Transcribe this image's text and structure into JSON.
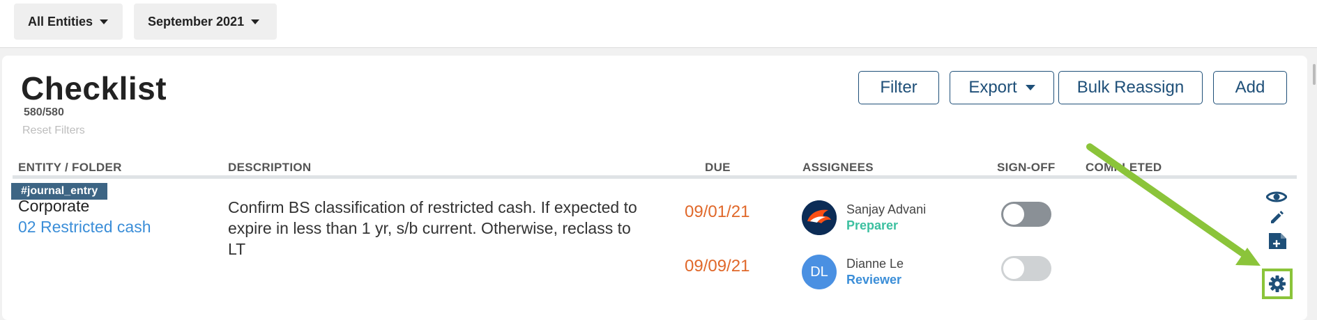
{
  "topbar": {
    "entities": "All Entities",
    "period": "September 2021"
  },
  "page": {
    "title": "Checklist",
    "count": "580/580",
    "reset": "Reset Filters"
  },
  "toolbar": {
    "filter": "Filter",
    "export": "Export",
    "bulk_reassign": "Bulk Reassign",
    "add": "Add"
  },
  "columns": {
    "entity": "ENTITY / FOLDER",
    "description": "DESCRIPTION",
    "due": "DUE",
    "assignees": "ASSIGNEES",
    "signoff": "SIGN-OFF",
    "completed": "COMPLETED"
  },
  "row": {
    "tag": "#journal_entry",
    "entity": "Corporate",
    "folder": "02 Restricted cash",
    "description": "Confirm BS classification of restricted cash. If expected to expire in less than 1 yr, s/b current. Otherwise, reclass to LT",
    "assignees": [
      {
        "due": "09/01/21",
        "name": "Sanjay Advani",
        "role": "Preparer",
        "initials": "",
        "role_color": "#3cc0a0",
        "signed": false
      },
      {
        "due": "09/09/21",
        "name": "Dianne Le",
        "role": "Reviewer",
        "initials": "DL",
        "role_color": "#3b8ed8",
        "signed": false
      }
    ]
  },
  "colors": {
    "primary": "#1e4f78",
    "due": "#e0682a",
    "link": "#3b8ed8",
    "highlight": "#8bc43a"
  },
  "icons": [
    "caret-down-icon",
    "eye-icon",
    "pencil-icon",
    "add-file-icon",
    "gear-icon",
    "arrow-annotation-icon",
    "broncos-logo-avatar"
  ]
}
